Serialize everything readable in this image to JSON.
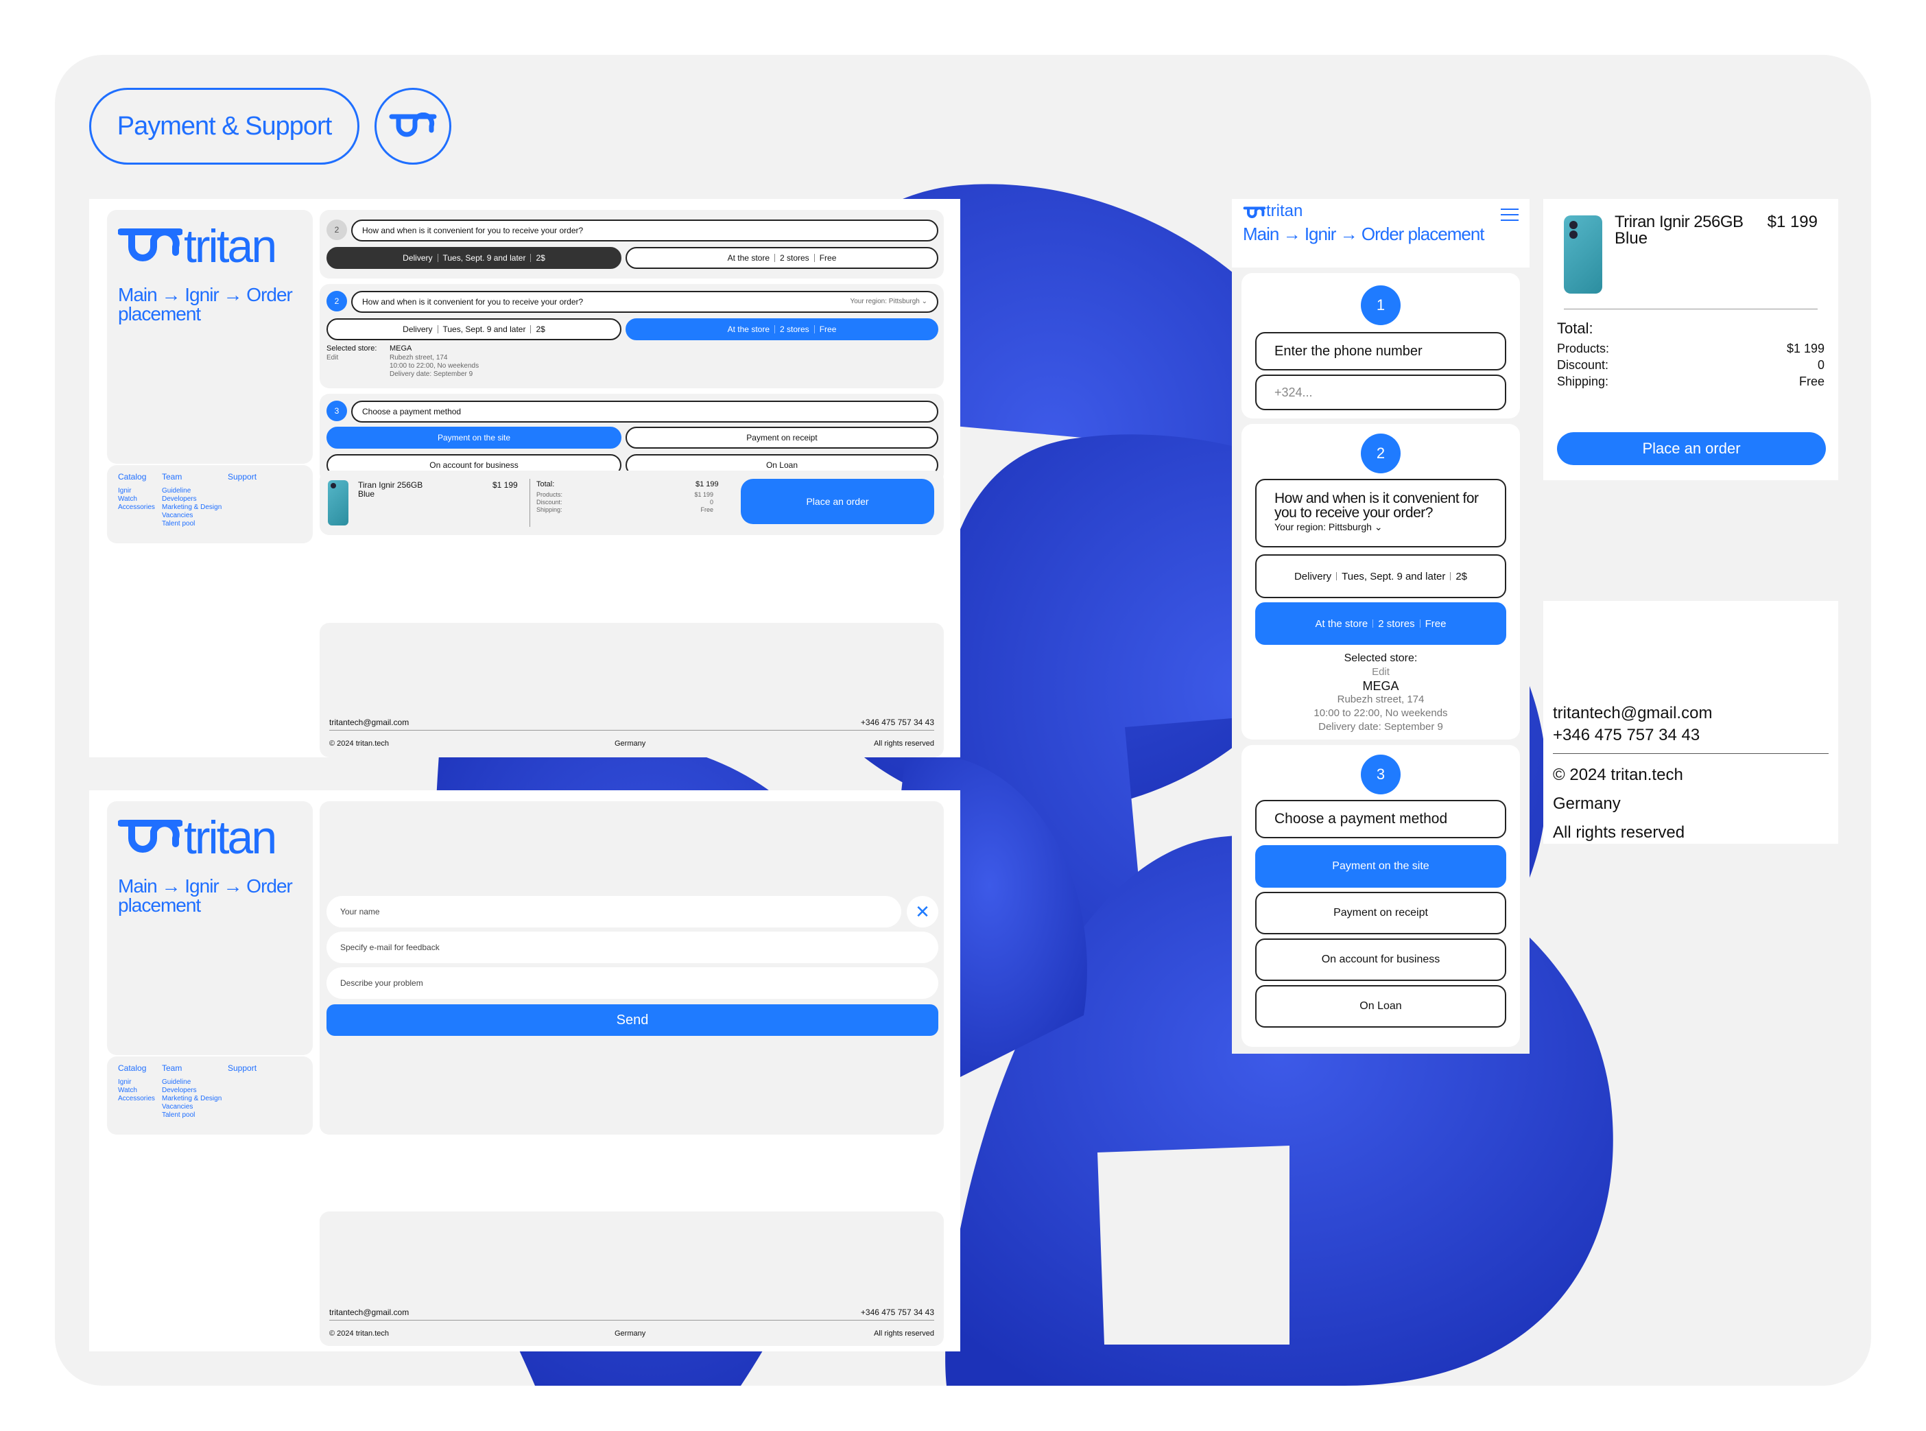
{
  "brand": {
    "name": "tritan",
    "accent": "#1f7bff",
    "dark": "#333333"
  },
  "header": {
    "title": "Payment & Support",
    "logo_icon": "tritan-logo-icon"
  },
  "breadcrumb": {
    "main": "Main",
    "ignir": "Ignir",
    "current": "Order placement",
    "current_a": "Order",
    "current_b": "placement",
    "arrow": "→"
  },
  "sidebar": {
    "col1_head": "Catalog",
    "col2_head": "Team",
    "col3_head": "Support",
    "col1": [
      "Ignir",
      "Watch",
      "Accessories"
    ],
    "col2": [
      "Guideline",
      "Developers",
      "Marketing & Design",
      "Vacancies",
      "Talent pool"
    ]
  },
  "step1": {
    "number": "1",
    "title": "Enter the phone number",
    "placeholder": "+324..."
  },
  "step2": {
    "number": "2",
    "title": "How and when is it convenient for you to receive your order?",
    "region_label": "Your region:",
    "region_value": "Pittsburgh",
    "delivery": {
      "label": "Delivery",
      "date": "Tues, Sept. 9 and later",
      "price": "2$"
    },
    "store": {
      "label": "At the store",
      "count": "2 stores",
      "price": "Free"
    },
    "selected_label": "Selected store:",
    "edit": "Edit",
    "store_name": "MEGA",
    "address": "Rubezh street, 174",
    "hours": "10:00 to 22:00, No weekends",
    "delivery_date": "Delivery date: September 9"
  },
  "step3": {
    "number": "3",
    "title": "Choose a payment method",
    "options": [
      "Payment on the site",
      "Payment on receipt",
      "On account for business",
      "On Loan"
    ]
  },
  "product": {
    "name": "Triran Ignir 256GB",
    "variant": "Blue",
    "name_alt": "Tiran Ignir 256GB",
    "price": "$1 199"
  },
  "totals": {
    "label": "Total:",
    "total": "$1 199",
    "products_label": "Products:",
    "products": "$1 199",
    "discount_label": "Discount:",
    "discount": "0",
    "shipping_label": "Shipping:",
    "shipping": "Free"
  },
  "order_button": "Place an order",
  "support_form": {
    "name_placeholder": "Your name",
    "email_placeholder": "Specify e-mail for feedback",
    "problem_placeholder": "Describe your problem",
    "send": "Send"
  },
  "footer": {
    "email": "tritantech@gmail.com",
    "phone": "+346 475 757 34 43",
    "copyright": "© 2024 tritan.tech",
    "country": "Germany",
    "rights": "All rights reserved"
  }
}
